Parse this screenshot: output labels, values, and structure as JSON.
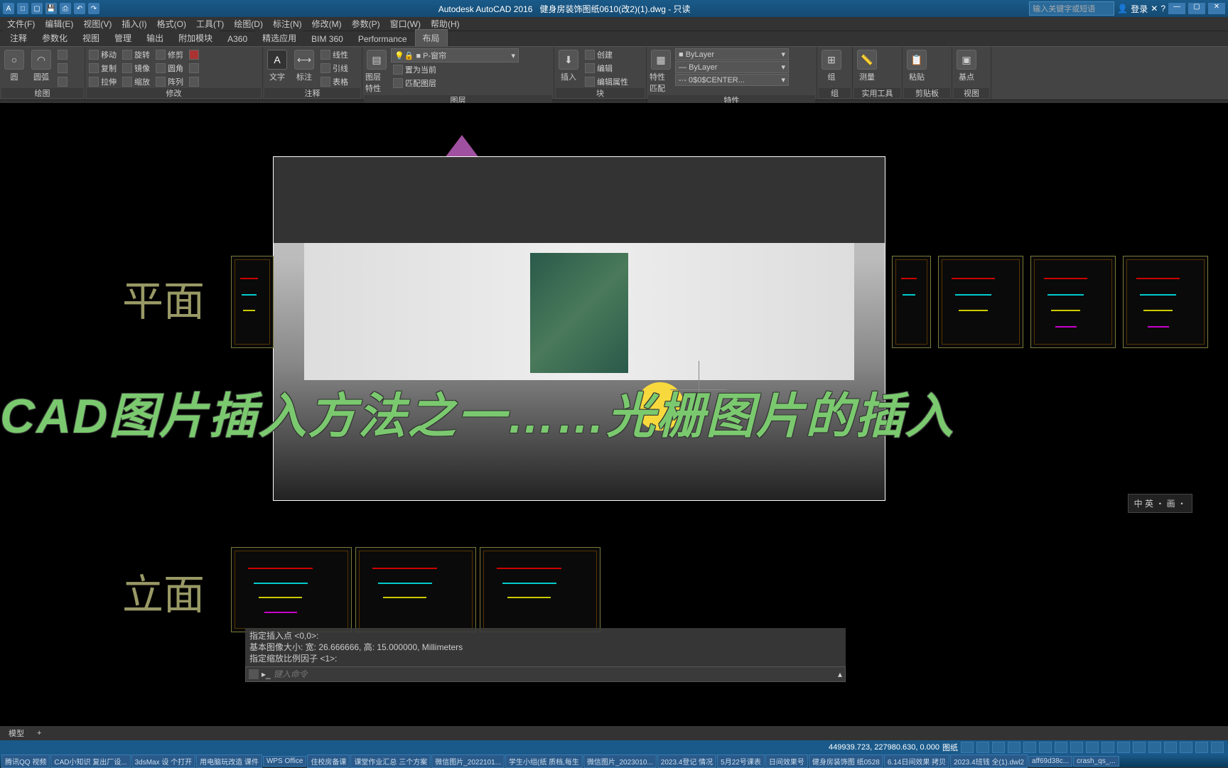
{
  "titlebar": {
    "app": "Autodesk AutoCAD 2016",
    "doc": "健身房装饰图纸0610(改2)(1).dwg - 只读",
    "search_ph": "输入关键字或短语",
    "login": "登录"
  },
  "menu": [
    "文件(F)",
    "编辑(E)",
    "视图(V)",
    "插入(I)",
    "格式(O)",
    "工具(T)",
    "绘图(D)",
    "标注(N)",
    "修改(M)",
    "参数(P)",
    "窗口(W)",
    "帮助(H)"
  ],
  "ribtabs": [
    "注释",
    "参数化",
    "视图",
    "管理",
    "输出",
    "附加模块",
    "A360",
    "精选应用",
    "BIM 360",
    "Performance",
    "布局"
  ],
  "ribtab_active": 10,
  "ribbon": {
    "draw_label": "绘图",
    "modify_label": "修改",
    "annot_label": "注释",
    "layer_label": "图层",
    "block_label": "块",
    "prop_label": "特性",
    "group_label": "组",
    "util_label": "实用工具",
    "clip_label": "剪贴板",
    "view_label": "视图",
    "tools": {
      "circle": "圆",
      "arc": "圆弧",
      "text": "文字",
      "dim": "标注",
      "move": "移动",
      "rotate": "旋转",
      "trim": "修剪",
      "copy": "复制",
      "mirror": "镜像",
      "fillet": "圆角",
      "stretch": "拉伸",
      "scale": "缩放",
      "array": "阵列",
      "linetype": "线性",
      "leader": "引线",
      "table": "表格",
      "layerprop": "图层特性",
      "setcur": "置为当前",
      "match": "匹配图层",
      "insert": "插入",
      "create": "创建",
      "edit": "编辑",
      "editattr": "编辑属性",
      "propmatch": "特性匹配",
      "bylayer": "ByLayer",
      "linestyle": "ByLayer",
      "scentner": "0$0$CENTER...",
      "layer_current": "P-窗帘",
      "group": "组",
      "measure": "测量",
      "paste": "粘贴",
      "base": "基点"
    }
  },
  "canvas": {
    "overlay": "CAD图片插入方法之一……光栅图片的插入",
    "label_plan": "平面",
    "label_elev": "立面",
    "ime": "中 英 ・ 画 ・"
  },
  "cmd": {
    "h1": "指定插入点 <0,0>:",
    "h2": "基本图像大小: 宽: 26.666666, 高: 15.000000, Millimeters",
    "h3": "指定缩放比例因子 <1>:",
    "placeholder": "键入命令"
  },
  "dwgtabs": [
    "模型",
    "+"
  ],
  "status": {
    "coords": "449939.723, 227980.630, 0.000",
    "paper": "图纸"
  },
  "taskbar": [
    "腾讯QQ 视频",
    "CAD小知识 复出厂设...",
    "3dsMax 设 个打开",
    "用电脑玩改造 课件",
    "WPS Office",
    "住校房备课",
    "课堂作业汇总 三个方案",
    "微信图片_2022101...",
    "学生小组(纸 质档,每生",
    "微信图片_2023010...",
    "2023.4登记 情况",
    "5月22号课表",
    "日间效果号",
    "健身房装饰图 纸0528",
    "6.14日间效果 拷贝",
    "2023.4班钱 全(1).dwl2",
    "aff69d38c...",
    "crash_qs_..."
  ]
}
